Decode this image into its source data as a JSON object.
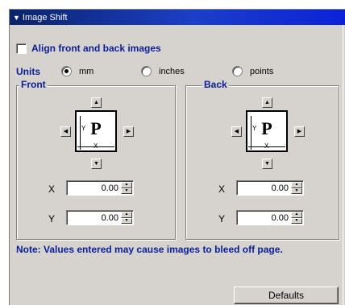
{
  "panel": {
    "title": "Image Shift",
    "align_label": "Align front and back images",
    "align_checked": false
  },
  "units": {
    "label": "Units",
    "options": [
      "mm",
      "inches",
      "points"
    ],
    "selected": "mm"
  },
  "front": {
    "title": "Front",
    "preview_letter": "P",
    "axis_x": "X",
    "axis_y": "Y",
    "x_label": "X",
    "x_value": "0.00",
    "y_label": "Y",
    "y_value": "0.00"
  },
  "back": {
    "title": "Back",
    "preview_letter": "P",
    "axis_x": "X",
    "axis_y": "Y",
    "x_label": "X",
    "x_value": "0.00",
    "y_label": "Y",
    "y_value": "0.00"
  },
  "note": "Note:  Values entered may cause images to bleed off page.",
  "defaults_label": "Defaults",
  "icons": {
    "collapse": "triangle-down-icon",
    "up": "triangle-up-icon",
    "down": "triangle-down-icon",
    "left": "triangle-left-icon",
    "right": "triangle-right-icon"
  },
  "colors": {
    "title_bar": "#0a246a",
    "accent_text": "#0a1e9a",
    "panel_bg": "#d6d3ce"
  }
}
